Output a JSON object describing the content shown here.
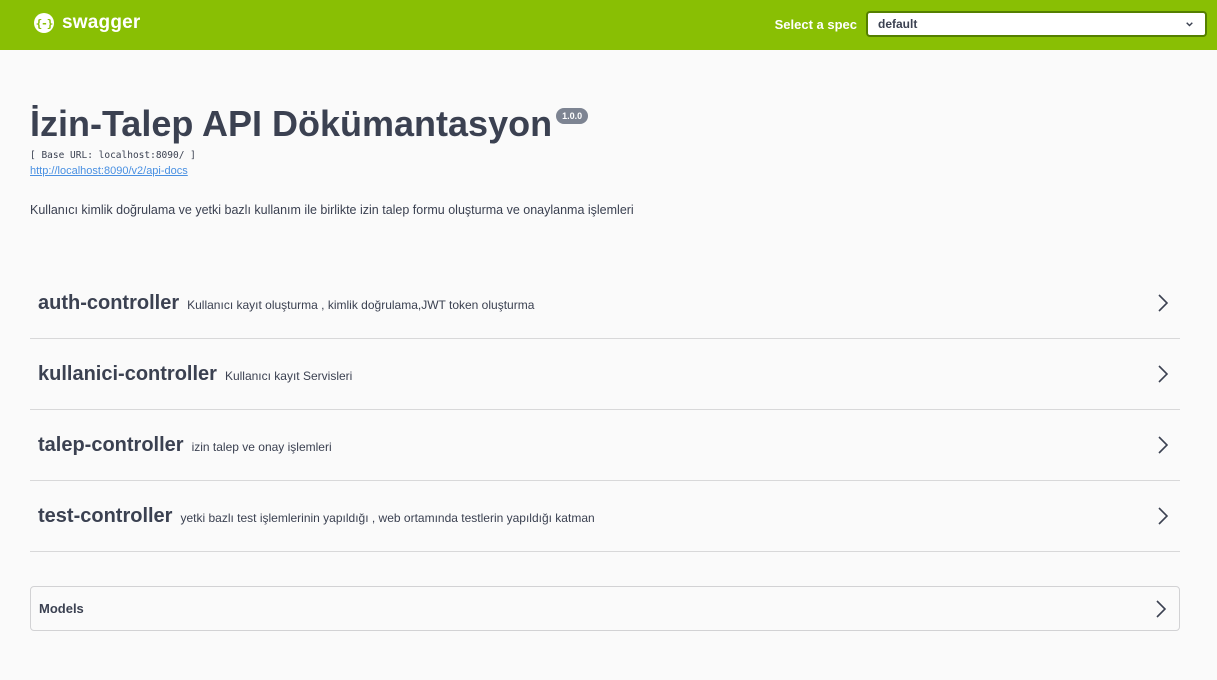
{
  "topbar": {
    "brand_logo_glyph": "{-}",
    "brand_name": "swagger",
    "spec_label": "Select a spec",
    "spec_selected": "default",
    "brand_color": "#89bf04"
  },
  "info": {
    "title": "İzin-Talep API Dökümantasyon",
    "version": "1.0.0",
    "base_url": "[ Base URL: localhost:8090/ ]",
    "api_docs_link": "http://localhost:8090/v2/api-docs",
    "description": "Kullanıcı kimlik doğrulama ve yetki bazlı kullanım ile birlikte izin talep formu oluşturma ve onaylanma işlemleri"
  },
  "tags": [
    {
      "name": "auth-controller",
      "description": "Kullanıcı kayıt oluşturma , kimlik doğrulama,JWT token oluşturma",
      "icon": "chevron-right-icon"
    },
    {
      "name": "kullanici-controller",
      "description": "Kullanıcı kayıt Servisleri",
      "icon": "chevron-right-icon"
    },
    {
      "name": "talep-controller",
      "description": "izin talep ve onay işlemleri",
      "icon": "chevron-right-icon"
    },
    {
      "name": "test-controller",
      "description": "yetki bazlı test işlemlerinin yapıldığı , web ortamında testlerin yapıldığı katman",
      "icon": "chevron-right-icon"
    }
  ],
  "models": {
    "label": "Models",
    "icon": "chevron-right-icon"
  }
}
